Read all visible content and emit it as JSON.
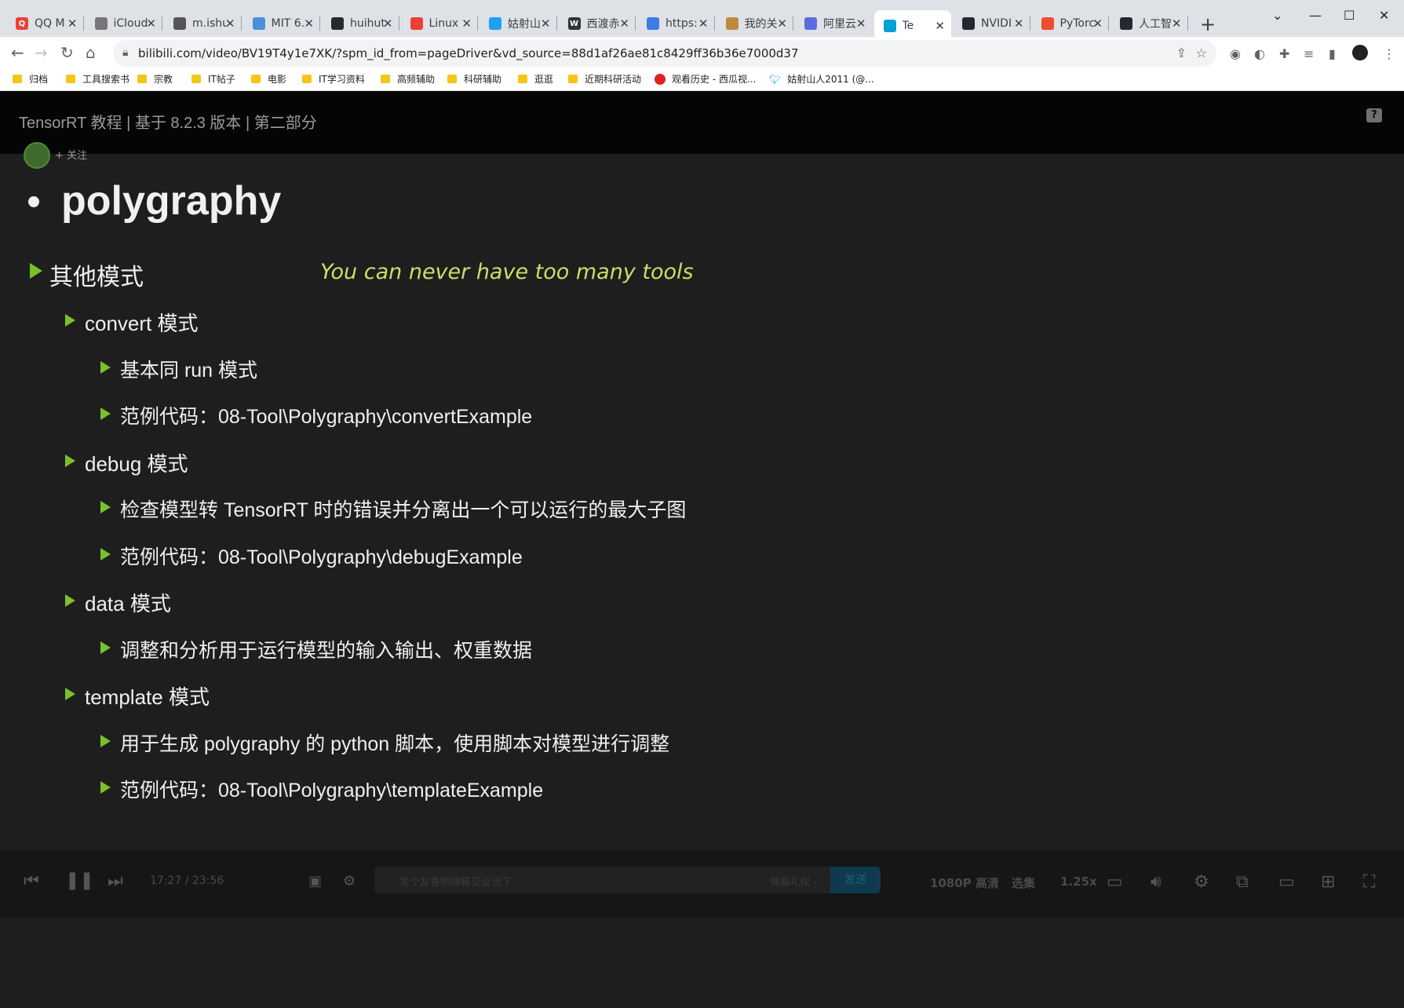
{
  "browser": {
    "tabs": [
      {
        "title": "QQ M",
        "color": "#e94235",
        "glyph": "Q"
      },
      {
        "title": "iCloud",
        "color": "#777777",
        "glyph": ""
      },
      {
        "title": "m.ishu",
        "color": "#555555",
        "glyph": ""
      },
      {
        "title": "MIT 6.",
        "color": "#4a90d9",
        "glyph": ""
      },
      {
        "title": "huihut",
        "color": "#24292e",
        "glyph": ""
      },
      {
        "title": "Linux",
        "color": "#e94235",
        "glyph": ""
      },
      {
        "title": "姑射山",
        "color": "#1da1f2",
        "glyph": ""
      },
      {
        "title": "西渡赤",
        "color": "#333333",
        "glyph": "W"
      },
      {
        "title": "https:",
        "color": "#3d7be5",
        "glyph": ""
      },
      {
        "title": "我的关",
        "color": "#c08a3e",
        "glyph": ""
      },
      {
        "title": "阿里云",
        "color": "#5b6ee1",
        "glyph": ""
      },
      {
        "title": "Te",
        "color": "#00a1d6",
        "glyph": ""
      },
      {
        "title": "NVIDI",
        "color": "#24292e",
        "glyph": ""
      },
      {
        "title": "PyTorc",
        "color": "#ee4c2c",
        "glyph": ""
      },
      {
        "title": "人工智",
        "color": "#24292e",
        "glyph": ""
      }
    ],
    "url": "bilibili.com/video/BV19T4y1e7XK/?spm_id_from=pageDriver&vd_source=88d1af26ae81c8429ff36b36e7000d37",
    "bookmarks": [
      "归档",
      "工具搜索书",
      "宗教",
      "IT帖子",
      "电影",
      "IT学习资料",
      "高频辅助",
      "科研辅助",
      "逛逛",
      "近期科研活动",
      "观看历史 - 西瓜视...",
      "姑射山人2011 (@..."
    ]
  },
  "video": {
    "title": "TensorRT 教程 | 基于 8.2.3 版本 | 第二部分",
    "follow_label": "+ 关注"
  },
  "slide": {
    "heading": "polygraphy",
    "section": "其他模式",
    "motto": "You can never have too many tools",
    "items": [
      {
        "level": 1,
        "text": "convert 模式"
      },
      {
        "level": 2,
        "text": "基本同 run 模式"
      },
      {
        "level": 2,
        "text": "范例代码：08-Tool\\Polygraphy\\convertExample"
      },
      {
        "level": 1,
        "text": "debug 模式"
      },
      {
        "level": 2,
        "text": "检查模型转 TensorRT 时的错误并分离出一个可以运行的最大子图"
      },
      {
        "level": 2,
        "text": "范例代码：08-Tool\\Polygraphy\\debugExample"
      },
      {
        "level": 1,
        "text": "data 模式"
      },
      {
        "level": 2,
        "text": "调整和分析用于运行模型的输入输出、权重数据"
      },
      {
        "level": 1,
        "text": "template 模式"
      },
      {
        "level": 2,
        "text": "用于生成 polygraphy 的 python 脚本，使用脚本对模型进行调整"
      },
      {
        "level": 2,
        "text": "范例代码：08-Tool\\Polygraphy\\templateExample"
      }
    ]
  },
  "player": {
    "time": "17:27 / 23:56",
    "danmaku_placeholder": "发个友善的弹幕见证当下",
    "danmaku_etiquette": "弹幕礼仪 ›",
    "send_label": "发送",
    "quality": "1080P 高清",
    "episodes": "选集",
    "speed": "1.25x"
  }
}
